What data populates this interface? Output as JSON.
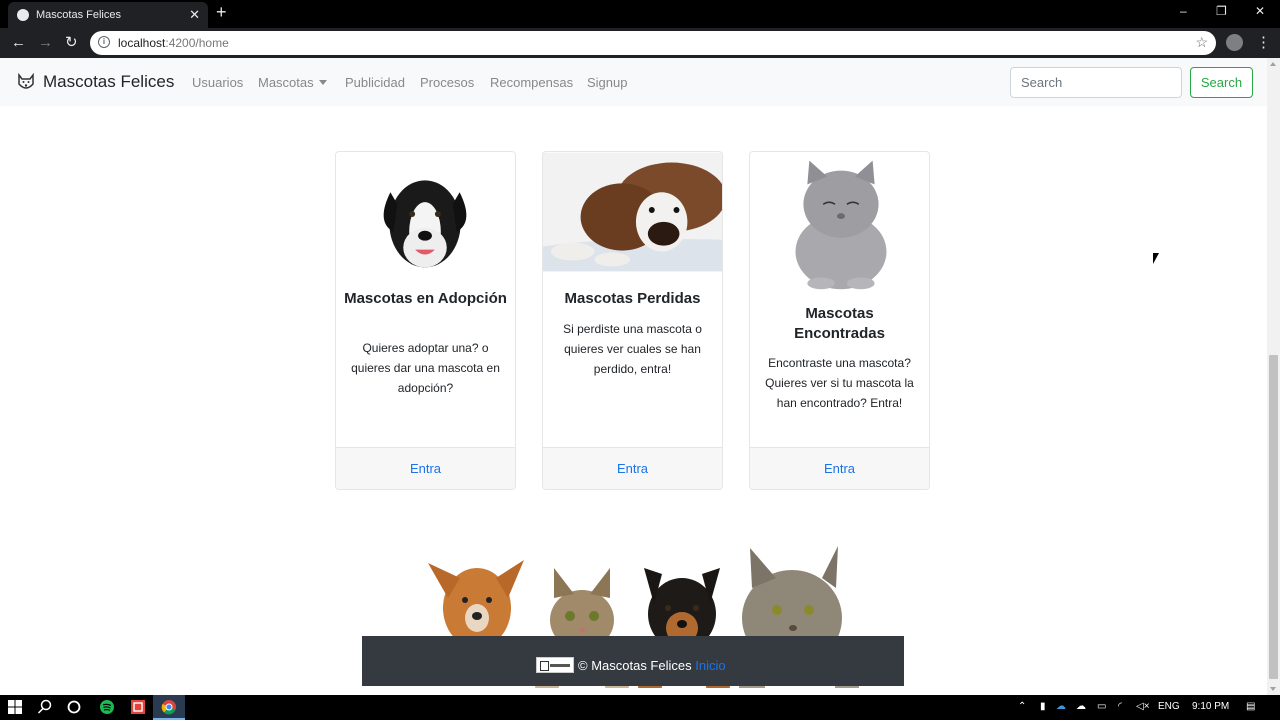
{
  "browser": {
    "tab_title": "Mascotas Felices",
    "new_tab_label": "+",
    "url_host": "localhost",
    "url_path": ":4200/home",
    "icons": [
      "chrome-favicon",
      "tab-close-icon",
      "back-icon",
      "forward-icon",
      "reload-icon",
      "info-icon",
      "bookmark-star-icon",
      "extension-icon",
      "menu-kebab-icon"
    ]
  },
  "window": {
    "minimize": "–",
    "maximize": "❐",
    "close": "✕"
  },
  "navbar": {
    "brand": "Mascotas Felices",
    "links": [
      "Usuarios",
      "Mascotas",
      "Publicidad",
      "Procesos",
      "Recompensas",
      "Signup"
    ],
    "search_placeholder": "Search",
    "search_button": "Search"
  },
  "cards": [
    {
      "title": "Mascotas en Adopción",
      "text": "Quieres adoptar una? o quieres dar una mascota en adopción?",
      "link": "Entra",
      "image": "black-white-dog-photo"
    },
    {
      "title": "Mascotas Perdidas",
      "text": "Si perdiste una mascota o quieres ver cuales se han perdido, entra!",
      "link": "Entra",
      "image": "boxer-dog-photo"
    },
    {
      "title": "Mascotas Encontradas",
      "text": "Encontraste una mascota? Quieres ver si tu mascota la han encontrado? Entra!",
      "link": "Entra",
      "image": "grey-cat-photo"
    }
  ],
  "footer": {
    "copyright": "© Mascotas Felices",
    "link": "Inicio",
    "image": "pets-banner-photo"
  },
  "taskbar": {
    "tray_lang": "ENG",
    "time": "9:10 PM"
  },
  "colors": {
    "navbar_bg": "#f8f9fa",
    "accent_green": "#28a745",
    "link_blue": "#1a73e8",
    "footer_bg": "#343a40"
  }
}
